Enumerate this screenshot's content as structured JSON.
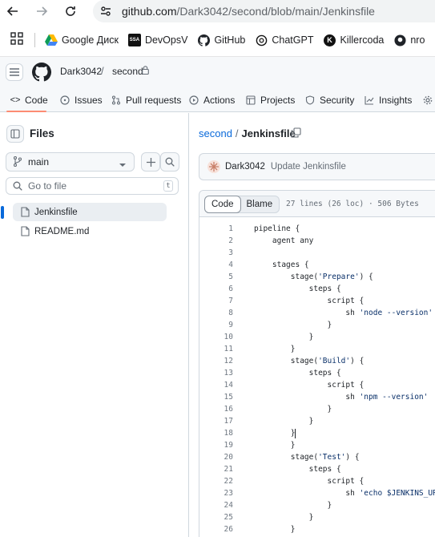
{
  "browser": {
    "url_host": "github.com",
    "url_path": "/Dark3042/second/blob/main/Jenkinsfile",
    "bookmarks": [
      {
        "label": "Google Диск",
        "icon": "google-drive-icon"
      },
      {
        "label": "DevOpsV",
        "icon": "ssa-icon"
      },
      {
        "label": "GitHub",
        "icon": "github-icon"
      },
      {
        "label": "ChatGPT",
        "icon": "chatgpt-icon"
      },
      {
        "label": "Killercoda",
        "icon": "killercoda-icon"
      },
      {
        "label": "nro",
        "icon": "github-icon"
      }
    ]
  },
  "header": {
    "owner": "Dark3042",
    "repo": "second",
    "tabs": [
      {
        "label": "Code",
        "icon": "code-icon"
      },
      {
        "label": "Issues",
        "icon": "issue-icon"
      },
      {
        "label": "Pull requests",
        "icon": "pull-request-icon"
      },
      {
        "label": "Actions",
        "icon": "play-icon"
      },
      {
        "label": "Projects",
        "icon": "table-icon"
      },
      {
        "label": "Security",
        "icon": "shield-icon"
      },
      {
        "label": "Insights",
        "icon": "graph-icon"
      }
    ]
  },
  "sidebar": {
    "title": "Files",
    "branch": "main",
    "goto_placeholder": "Go to file",
    "goto_shortcut": "t",
    "files": [
      {
        "name": "Jenkinsfile",
        "active": true
      },
      {
        "name": "README.md",
        "active": false
      }
    ]
  },
  "main": {
    "repo_link": "second",
    "file_name": "Jenkinsfile",
    "commit_author": "Dark3042",
    "commit_message": "Update Jenkinsfile",
    "view_code": "Code",
    "view_blame": "Blame",
    "file_meta": "27 lines (26 loc) · 506 Bytes",
    "code_lines": [
      "pipeline {",
      "    agent any",
      "",
      "    stages {",
      "        stage('Prepare') {",
      "            steps {",
      "                script {",
      "                    sh 'node --version'",
      "                }",
      "            }",
      "        }",
      "        stage('Build') {",
      "            steps {",
      "                script {",
      "                    sh 'npm --version'",
      "                }",
      "            }",
      "        }",
      "        }",
      "        stage('Test') {",
      "            steps {",
      "                script {",
      "                    sh 'echo $JENKINS_URL'",
      "                }",
      "            }",
      "        }",
      "    }"
    ]
  },
  "colors": {
    "accent_link": "#0969da",
    "tab_underline": "#fd8c73",
    "string": "#0a3069"
  }
}
